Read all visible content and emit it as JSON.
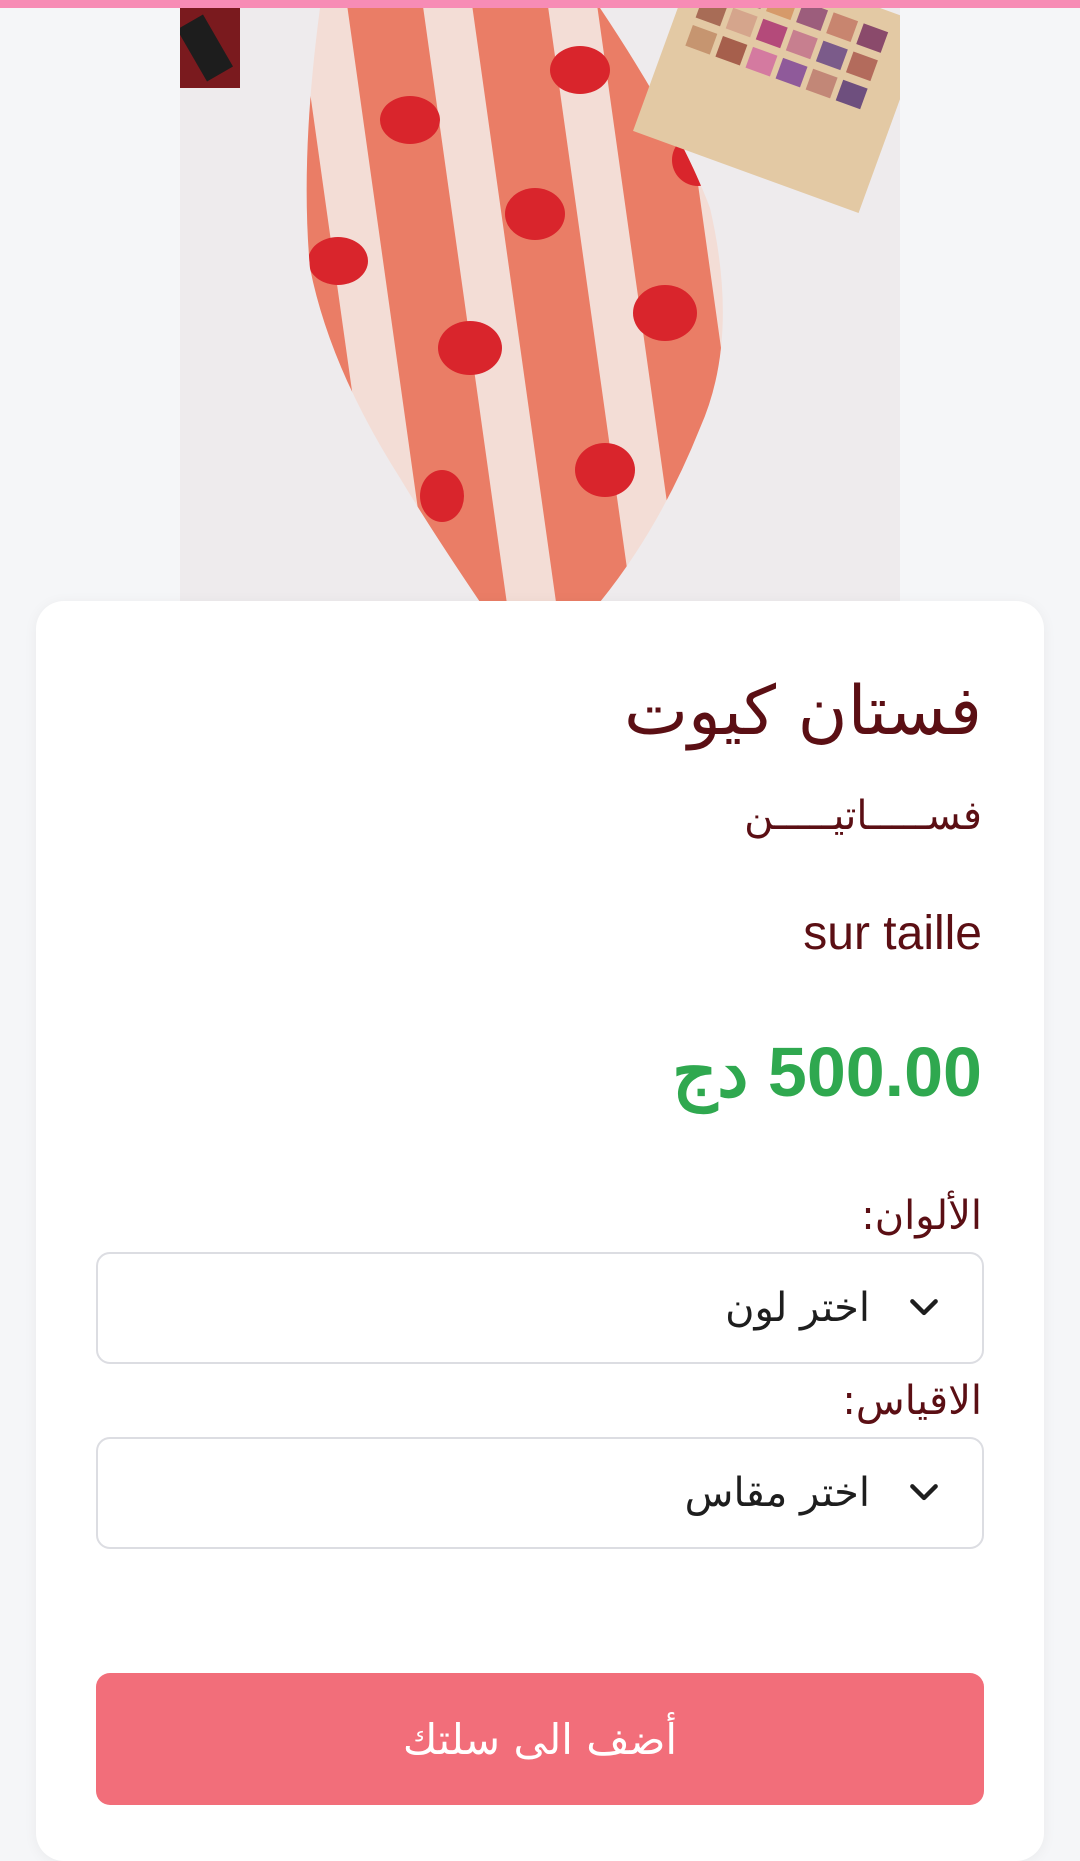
{
  "product": {
    "title": "فستان كيوت",
    "category": "فســـــاتيـــــن",
    "subtitle": "sur taille",
    "price_amount": "500.00",
    "currency": "دج"
  },
  "options": {
    "colors": {
      "label": "الألوان:",
      "selected": "اختر لون"
    },
    "sizes": {
      "label": "الاقياس:",
      "selected": "اختر مقاس"
    }
  },
  "actions": {
    "add_to_cart_label": "أضف الى سلتك"
  },
  "colors": {
    "accent_bar": "#f78cb5",
    "title_text": "#5b0f14",
    "price_text": "#2fa84f",
    "button_bg": "#f26e7a"
  }
}
